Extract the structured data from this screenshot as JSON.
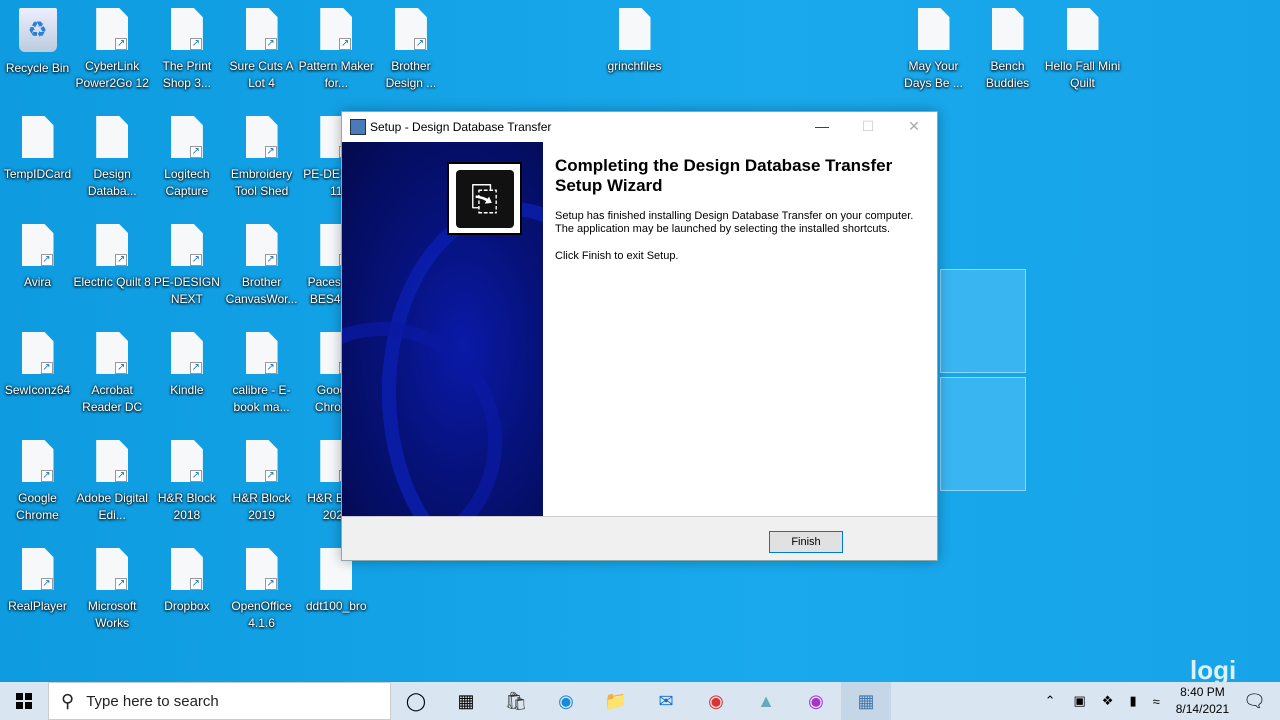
{
  "desktop": {
    "icons": [
      {
        "label": "Recycle Bin",
        "icon": "recycle-bin-icon"
      },
      {
        "label": "TempIDCard",
        "icon": "file-icon"
      },
      {
        "label": "Avira",
        "icon": "shortcut-icon"
      },
      {
        "label": "SewIconz64",
        "icon": "shortcut-icon"
      },
      {
        "label": "Google Chrome",
        "icon": "shortcut-icon"
      },
      {
        "label": "RealPlayer",
        "icon": "shortcut-icon"
      },
      {
        "label": "CyberLink Power2Go 12",
        "icon": "shortcut-icon"
      },
      {
        "label": "Design Databa...",
        "icon": "file-icon"
      },
      {
        "label": "Electric Quilt 8",
        "icon": "shortcut-icon"
      },
      {
        "label": "Acrobat Reader DC",
        "icon": "shortcut-icon"
      },
      {
        "label": "Adobe Digital Edi...",
        "icon": "shortcut-icon"
      },
      {
        "label": "Microsoft Works",
        "icon": "shortcut-icon"
      },
      {
        "label": "The Print Shop 3...",
        "icon": "shortcut-icon"
      },
      {
        "label": "Logitech Capture",
        "icon": "shortcut-icon"
      },
      {
        "label": "PE-DESIGN NEXT",
        "icon": "shortcut-icon"
      },
      {
        "label": "Kindle",
        "icon": "shortcut-icon"
      },
      {
        "label": "H&R Block 2018",
        "icon": "shortcut-icon"
      },
      {
        "label": "Dropbox",
        "icon": "shortcut-icon"
      },
      {
        "label": "Sure Cuts A Lot 4",
        "icon": "shortcut-icon"
      },
      {
        "label": "Embroidery Tool Shed",
        "icon": "shortcut-icon"
      },
      {
        "label": "Brother CanvasWor...",
        "icon": "shortcut-icon"
      },
      {
        "label": "calibre - E-book ma...",
        "icon": "shortcut-icon"
      },
      {
        "label": "H&R Block 2019",
        "icon": "shortcut-icon"
      },
      {
        "label": "OpenOffice 4.1.6",
        "icon": "shortcut-icon"
      },
      {
        "label": "Pattern Maker for...",
        "icon": "shortcut-icon"
      },
      {
        "label": "PE-DESIGN 11",
        "icon": "shortcut-icon"
      },
      {
        "label": "Pacesetter BES4 D...",
        "icon": "shortcut-icon"
      },
      {
        "label": "Google Chrome",
        "icon": "shortcut-icon"
      },
      {
        "label": "H&R Block 2020",
        "icon": "shortcut-icon"
      },
      {
        "label": "ddt100_bro",
        "icon": "file-icon"
      },
      {
        "label": "Brother Design ...",
        "icon": "shortcut-icon"
      }
    ],
    "free_icons": [
      {
        "label": "grinchfiles",
        "icon": "file-icon"
      },
      {
        "label": "May Your Days Be ...",
        "icon": "file-icon"
      },
      {
        "label": "Bench Buddies",
        "icon": "file-icon"
      },
      {
        "label": "Hello Fall Mini Quilt",
        "icon": "file-icon"
      }
    ]
  },
  "dialog": {
    "title": "Setup - Design Database Transfer",
    "heading": "Completing the Design Database Transfer Setup Wizard",
    "text1": "Setup has finished installing Design Database Transfer on your computer. The application may be launched by selecting the installed shortcuts.",
    "text2": "Click Finish to exit Setup.",
    "finish": "Finish"
  },
  "taskbar": {
    "search_placeholder": "Type here to search",
    "apps": [
      "cortana-icon",
      "task-view-icon",
      "store-icon",
      "edge-icon",
      "file-explorer-icon",
      "mail-icon",
      "chrome-icon",
      "app-icon",
      "capture-icon",
      "setup-icon"
    ],
    "time": "8:40 PM",
    "date": "8/14/2021"
  },
  "watermark": "logi"
}
